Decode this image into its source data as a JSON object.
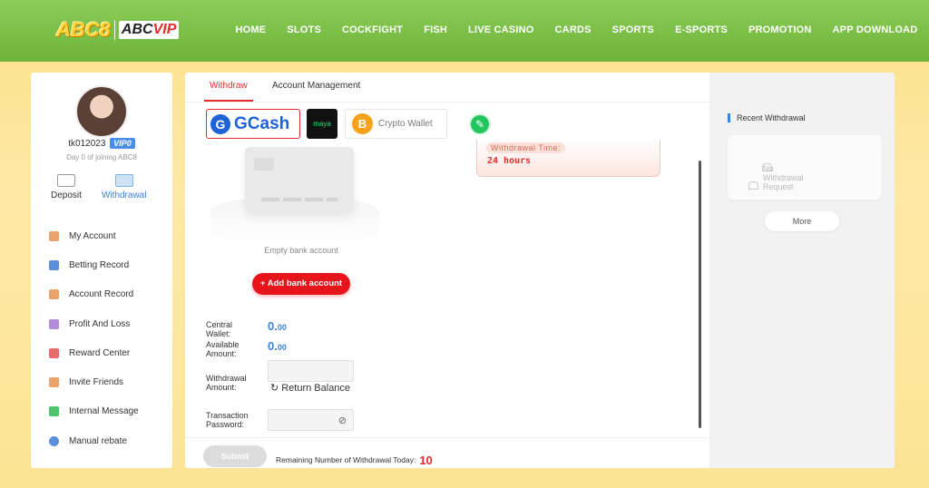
{
  "header": {
    "logo_main": "ABC8",
    "logo_vip_prefix": "ABC",
    "logo_vip_suffix": "VIP",
    "nav": [
      "HOME",
      "SLOTS",
      "COCKFIGHT",
      "FISH",
      "LIVE CASINO",
      "CARDS",
      "SPORTS",
      "E-SPORTS",
      "PROMOTION",
      "APP DOWNLOAD"
    ]
  },
  "sidebar": {
    "username": "tk012023",
    "vip_badge": "VIP0",
    "day_info": "Day 0 of joining ABC8",
    "deposit_label": "Deposit",
    "withdrawal_label": "Withdrawal",
    "menu": [
      {
        "label": "My Account",
        "icon": "wallet-icon",
        "color": "#e9a36b"
      },
      {
        "label": "Betting Record",
        "icon": "list-icon",
        "color": "#5b8fd8"
      },
      {
        "label": "Account Record",
        "icon": "ledger-icon",
        "color": "#e9a36b"
      },
      {
        "label": "Profit And Loss",
        "icon": "chart-icon",
        "color": "#b38ad8"
      },
      {
        "label": "Reward Center",
        "icon": "gift-icon",
        "color": "#e86b6b"
      },
      {
        "label": "Invite Friends",
        "icon": "people-icon",
        "color": "#e9a36b"
      },
      {
        "label": "Internal Message",
        "icon": "message-icon",
        "color": "#4cc46b"
      },
      {
        "label": "Manual rebate",
        "icon": "rebate-icon",
        "color": "#5b8fd8"
      }
    ]
  },
  "main": {
    "tabs": [
      "Withdraw",
      "Account Management"
    ],
    "methods": {
      "gcash_letter": "G",
      "gcash_text": "GCash",
      "maya_text": "maya",
      "crypto_letter": "B",
      "crypto_text": "Crypto Wallet"
    },
    "notice_label": "Withdrawal Time:",
    "notice_value": "24 hours",
    "empty_text": "Empty bank account",
    "add_bank_label": "Add bank account",
    "central_wallet_label": "Central Wallet:",
    "central_wallet_int": "0.",
    "central_wallet_dec": "00",
    "available_label": "Available Amount:",
    "available_int": "0.",
    "available_dec": "00",
    "withdrawal_amount_label": "Withdrawal Amount:",
    "return_balance_label": "Return Balance",
    "password_label": "Transaction Password:",
    "submit_label": "Submit",
    "remaining_label": "Remaining Number of Withdrawal Today:",
    "remaining_value": "10"
  },
  "right": {
    "title": "Recent Withdrawal",
    "empty": "No Withdrawal Request",
    "more": "More"
  },
  "colors": {
    "accent": "#e52b2b",
    "link": "#3b82d8",
    "topbar": "#7cbf48"
  }
}
